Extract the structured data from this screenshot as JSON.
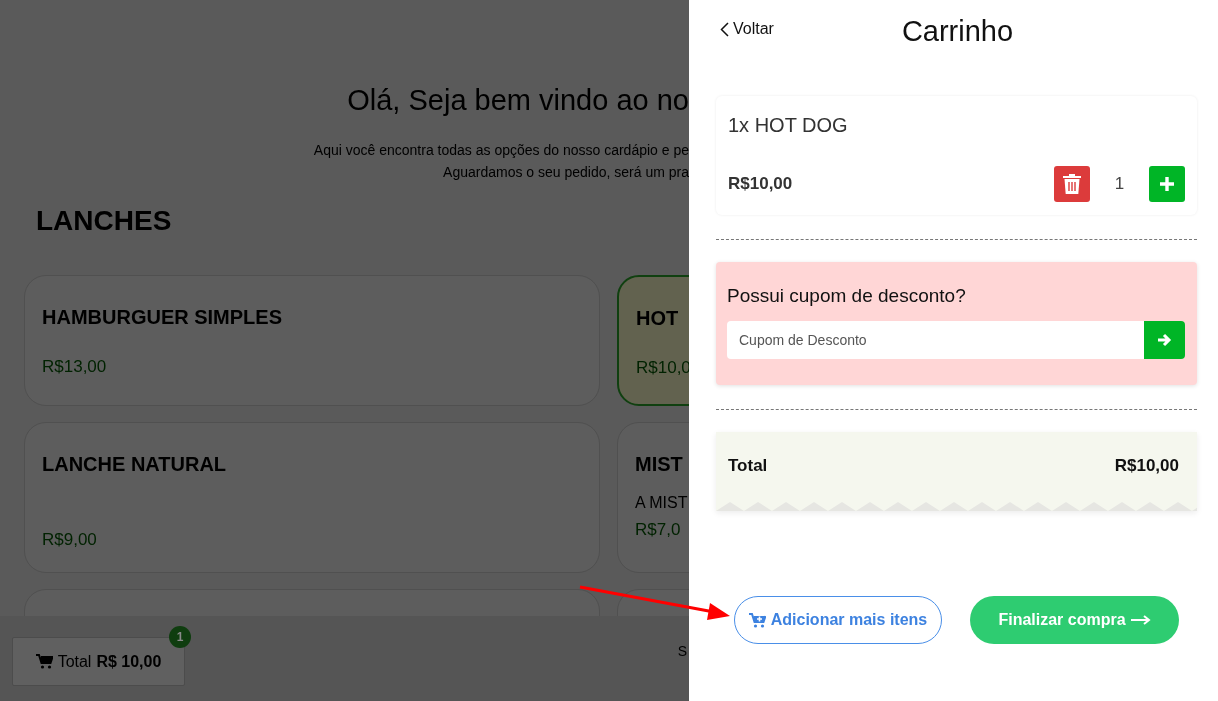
{
  "background_page": {
    "heading": "Olá, Seja bem vindo ao no",
    "intro_lines": [
      "Aqui você encontra todas as opções do nosso cardápio e pe",
      "Aguardamos o seu pedido, será um pra"
    ],
    "section_title": "LANCHES",
    "products": [
      {
        "name": "HAMBURGUER SIMPLES",
        "price": "R$13,00",
        "selected": false
      },
      {
        "name": "HOT",
        "price": "R$10,0",
        "selected": true
      },
      {
        "name": "LANCHE NATURAL",
        "price": "R$9,00",
        "selected": false
      },
      {
        "name": "MIST",
        "description": "A MIST",
        "price": "R$7,0",
        "selected": false
      }
    ],
    "footer": {
      "cart_button": {
        "label": "Total",
        "amount": "R$ 10,00",
        "badge": "1"
      },
      "column_2": "S"
    }
  },
  "cart": {
    "back_link": "Voltar",
    "title": "Carrinho",
    "items": [
      {
        "name": "1x HOT DOG",
        "price": "R$10,00",
        "quantity": "1"
      }
    ],
    "coupon": {
      "question": "Possui cupom de desconto?",
      "placeholder": "Cupom de Desconto"
    },
    "total": {
      "label": "Total",
      "value": "R$10,00"
    },
    "buttons": [
      {
        "kind": "outline",
        "label": "Adicionar mais itens"
      },
      {
        "kind": "primary",
        "label": "Finalizar compra"
      }
    ]
  }
}
